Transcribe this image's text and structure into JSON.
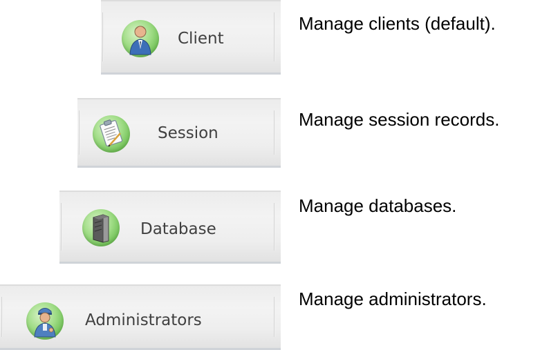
{
  "buttons": [
    {
      "label": "Client",
      "icon": "client-user-icon",
      "description": "Manage clients (default)."
    },
    {
      "label": "Session",
      "icon": "session-clipboard-icon",
      "description": "Manage session records."
    },
    {
      "label": "Database",
      "icon": "database-server-icon",
      "description": "Manage databases."
    },
    {
      "label": "Administrators",
      "icon": "administrator-user-icon",
      "description": "Manage administrators."
    }
  ]
}
